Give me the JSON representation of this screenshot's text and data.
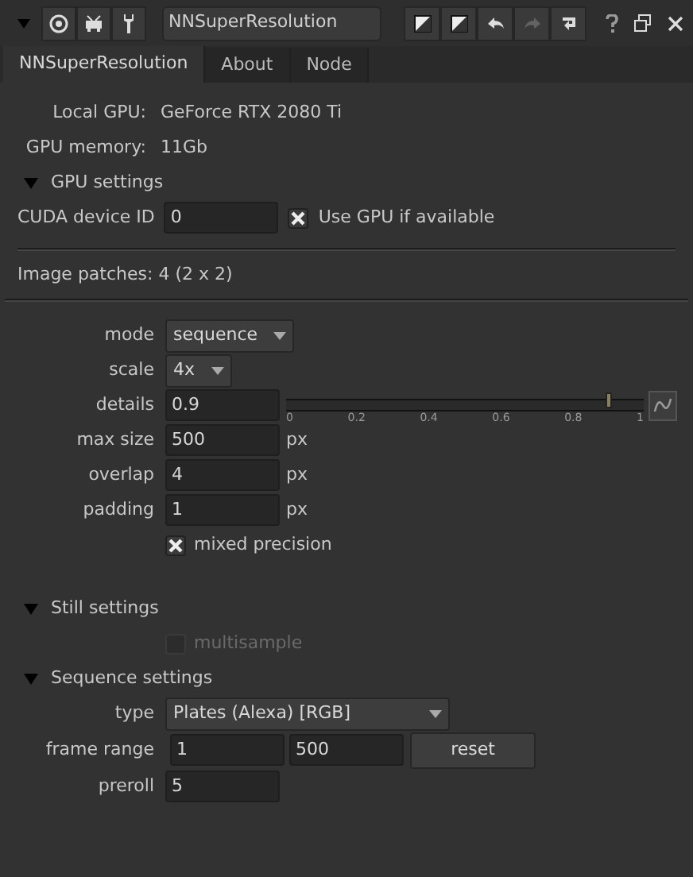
{
  "toolbar": {
    "node_name": "NNSuperResolution",
    "tools": [
      {
        "kind": "collapse",
        "disabled": false
      },
      {
        "kind": "target",
        "disabled": false
      },
      {
        "kind": "viewer",
        "disabled": false
      },
      {
        "kind": "wrench",
        "disabled": false
      }
    ],
    "actions": [
      {
        "kind": "diag",
        "disabled": false
      },
      {
        "kind": "diag",
        "disabled": false
      },
      {
        "kind": "undo",
        "disabled": false
      },
      {
        "kind": "redo",
        "disabled": true
      },
      {
        "kind": "revert",
        "disabled": false
      }
    ],
    "window": [
      {
        "kind": "help"
      },
      {
        "kind": "float"
      },
      {
        "kind": "close"
      }
    ]
  },
  "tabs": [
    {
      "label": "NNSuperResolution",
      "selected": true
    },
    {
      "label": "About",
      "selected": false
    },
    {
      "label": "Node",
      "selected": false
    }
  ],
  "gpu_info": [
    {
      "label": "Local GPU:",
      "value": "GeForce RTX 2080 Ti"
    },
    {
      "label": "GPU memory:",
      "value": "11Gb"
    }
  ],
  "gpu_settings": {
    "title": "GPU settings",
    "expanded": true,
    "cuda_label": "CUDA device ID",
    "cuda_value": "0",
    "use_gpu": {
      "label": "Use GPU if available",
      "checked": true
    }
  },
  "image_patches": "Image patches: 4 (2 x 2)",
  "knobs": [
    {
      "kind": "dropdown",
      "label": "mode",
      "value": "sequence"
    },
    {
      "kind": "dropdown",
      "label": "scale",
      "value": "4x"
    },
    {
      "kind": "slider",
      "label": "details",
      "value": "0.9",
      "level": 0.9,
      "ticks": [
        "0",
        "0.2",
        "0.4",
        "0.6",
        "0.8",
        "1"
      ]
    },
    {
      "kind": "number",
      "label": "max size",
      "value": "500",
      "unit": "px"
    },
    {
      "kind": "number",
      "label": "overlap",
      "value": "4",
      "unit": "px"
    },
    {
      "kind": "number",
      "label": "padding",
      "value": "1",
      "unit": "px"
    },
    {
      "kind": "checkbox",
      "label": "mixed precision",
      "checked": true,
      "disabled": false
    }
  ],
  "still_settings": {
    "title": "Still settings",
    "expanded": true,
    "knobs": [
      {
        "kind": "checkbox",
        "label": "multisample",
        "checked": false,
        "disabled": true
      }
    ]
  },
  "sequence_settings": {
    "title": "Sequence settings",
    "expanded": true,
    "knobs": [
      {
        "kind": "dropdown",
        "label": "type",
        "value": "Plates (Alexa) [RGB]",
        "wide": true
      },
      {
        "kind": "range",
        "label": "frame range",
        "from": "1",
        "to": "500",
        "button": "reset"
      },
      {
        "kind": "number",
        "label": "preroll",
        "value": "5"
      }
    ]
  }
}
